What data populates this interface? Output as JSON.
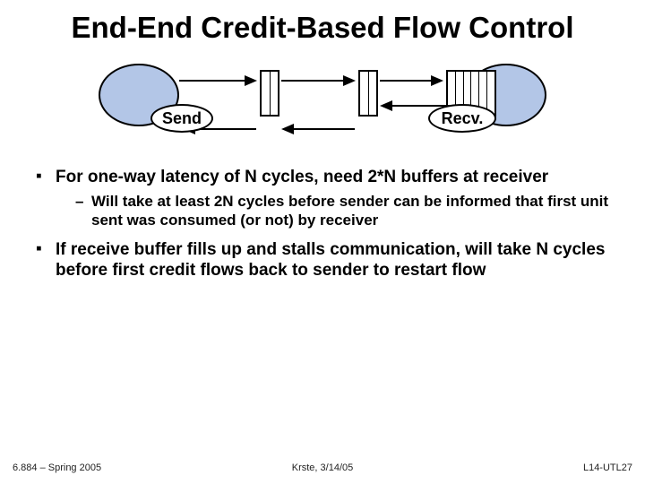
{
  "title": "End-End Credit-Based Flow Control",
  "diagram": {
    "send_label": "Send",
    "recv_label": "Recv."
  },
  "bullets": {
    "b1": "For one-way latency of N cycles, need 2*N buffers at receiver",
    "b1s1": "Will take at least 2N cycles before sender can be informed that first unit sent was consumed (or not) by receiver",
    "b2": "If receive buffer fills up and stalls communication, will take N cycles before first credit flows back to sender to restart flow"
  },
  "footer": {
    "left": "6.884 – Spring 2005",
    "center": "Krste, 3/14/05",
    "right": "L14-UTL27"
  }
}
